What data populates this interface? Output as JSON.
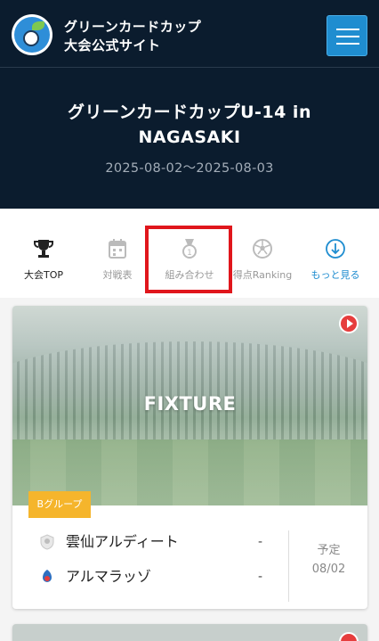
{
  "header": {
    "site_title_line1": "グリーンカードカップ",
    "site_title_line2": "大会公式サイト"
  },
  "hero": {
    "title": "グリーンカードカップU-14 in NAGASAKI",
    "dates": "2025-08-02〜2025-08-03"
  },
  "nav": {
    "items": [
      {
        "label": "大会TOP",
        "icon": "trophy-icon",
        "color": "#222222"
      },
      {
        "label": "対戦表",
        "icon": "calendar-icon",
        "color": "#999999"
      },
      {
        "label": "組み合わせ",
        "icon": "medal-icon",
        "color": "#999999"
      },
      {
        "label": "得点Ranking",
        "icon": "soccer-ball-icon",
        "color": "#999999"
      },
      {
        "label": "もっと見る",
        "icon": "arrow-down-circle-icon",
        "color": "#1f8dd0"
      }
    ]
  },
  "match": {
    "image_label": "FIXTURE",
    "group": "Bグループ",
    "home_team": "雲仙アルディート",
    "away_team": "アルマラッゾ",
    "home_score": "-",
    "away_score": "-",
    "status": "予定",
    "date": "08/02"
  },
  "colors": {
    "header_bg": "#0b1c2e",
    "accent_blue": "#1f8dd0",
    "highlight_red": "#e0161c",
    "badge_orange": "#f5b52c"
  }
}
